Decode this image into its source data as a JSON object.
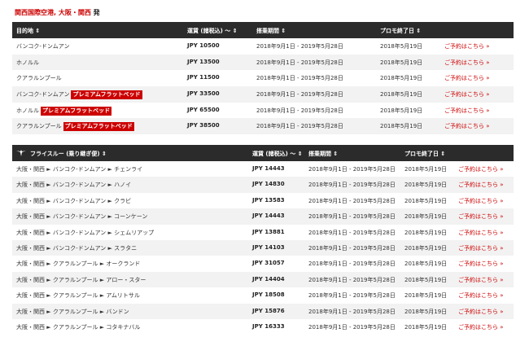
{
  "page": {
    "origin": "関西国際空港, 大阪・関西",
    "origin_suffix": "発"
  },
  "table1": {
    "headers": {
      "destination": "目的地 ⇕",
      "fare": "運賃 (諸税込) ～ ⇕",
      "period": "搭乗期間 ⇕",
      "promo_end": "プロモ終了日 ⇕"
    },
    "rows": [
      {
        "dest": "バンコク-ドンムアン",
        "badge": "",
        "fare": "JPY 10500",
        "period": "2018年9月1日 - 2019年5月28日",
        "end": "2018年5月19日",
        "link": "ご予約はこちら »"
      },
      {
        "dest": "ホノルル",
        "badge": "",
        "fare": "JPY 13500",
        "period": "2018年9月1日 - 2019年5月28日",
        "end": "2018年5月19日",
        "link": "ご予約はこちら »"
      },
      {
        "dest": "クアラルンプール",
        "badge": "",
        "fare": "JPY 11500",
        "period": "2018年9月1日 - 2019年5月28日",
        "end": "2018年5月19日",
        "link": "ご予約はこちら »"
      },
      {
        "dest": "バンコク-ドンムアン",
        "badge": "プレミアムフラットベッド",
        "fare": "JPY 33500",
        "period": "2018年9月1日 - 2019年5月28日",
        "end": "2018年5月19日",
        "link": "ご予約はこちら »"
      },
      {
        "dest": "ホノルル",
        "badge": "プレミアムフラットベッド",
        "fare": "JPY 65500",
        "period": "2018年9月1日 - 2019年5月28日",
        "end": "2018年5月19日",
        "link": "ご予約はこちら »"
      },
      {
        "dest": "クアラルンプール",
        "badge": "プレミアムフラットベッド",
        "fare": "JPY 38500",
        "period": "2018年9月1日 - 2019年5月28日",
        "end": "2018年5月19日",
        "link": "ご予約はこちら »"
      }
    ]
  },
  "table2": {
    "headers": {
      "destination": "フライスルー (乗り継ぎ便) ⇕",
      "fare": "運賃 (諸税込) ～ ⇕",
      "period": "搭乗期間 ⇕",
      "promo_end": "プロモ終了日 ⇕"
    },
    "rows": [
      {
        "dest": "大阪・関西 ► バンコク-ドンムアン ► チェンライ",
        "fare": "JPY 14443",
        "period": "2018年9月1日 - 2019年5月28日",
        "end": "2018年5月19日",
        "link": "ご予約はこちら »"
      },
      {
        "dest": "大阪・関西 ► バンコク-ドンムアン ► ハノイ",
        "fare": "JPY 14830",
        "period": "2018年9月1日 - 2019年5月28日",
        "end": "2018年5月19日",
        "link": "ご予約はこちら »"
      },
      {
        "dest": "大阪・関西 ► バンコク-ドンムアン ► クラビ",
        "fare": "JPY 13583",
        "period": "2018年9月1日 - 2019年5月28日",
        "end": "2018年5月19日",
        "link": "ご予約はこちら »"
      },
      {
        "dest": "大阪・関西 ► バンコク-ドンムアン ► コーンケーン",
        "fare": "JPY 14443",
        "period": "2018年9月1日 - 2019年5月28日",
        "end": "2018年5月19日",
        "link": "ご予約はこちら »"
      },
      {
        "dest": "大阪・関西 ► バンコク-ドンムアン ► シェムリアップ",
        "fare": "JPY 13881",
        "period": "2018年9月1日 - 2019年5月28日",
        "end": "2018年5月19日",
        "link": "ご予約はこちら »"
      },
      {
        "dest": "大阪・関西 ► バンコク-ドンムアン ► スラタニ",
        "fare": "JPY 14103",
        "period": "2018年9月1日 - 2019年5月28日",
        "end": "2018年5月19日",
        "link": "ご予約はこちら »"
      },
      {
        "dest": "大阪・関西 ► クアラルンプール ► オークランド",
        "fare": "JPY 31057",
        "period": "2018年9月1日 - 2019年5月28日",
        "end": "2018年5月19日",
        "link": "ご予約はこちら »"
      },
      {
        "dest": "大阪・関西 ► クアラルンプール ► アロー・スター",
        "fare": "JPY 14404",
        "period": "2018年9月1日 - 2019年5月28日",
        "end": "2018年5月19日",
        "link": "ご予約はこちら »"
      },
      {
        "dest": "大阪・関西 ► クアラルンプール ► アムリトサル",
        "fare": "JPY 18508",
        "period": "2018年9月1日 - 2019年5月28日",
        "end": "2018年5月19日",
        "link": "ご予約はこちら »"
      },
      {
        "dest": "大阪・関西 ► クアラルンプール ► バンドン",
        "fare": "JPY 15876",
        "period": "2018年9月1日 - 2019年5月28日",
        "end": "2018年5月19日",
        "link": "ご予約はこちら »"
      },
      {
        "dest": "大阪・関西 ► クアラルンプール ► コタキナバル",
        "fare": "JPY 16333",
        "period": "2018年9月1日 - 2019年5月28日",
        "end": "2018年5月19日",
        "link": "ご予約はこちら »"
      }
    ]
  },
  "colors": {
    "accent": "#cc0000",
    "header_bg": "#2b2b2b",
    "row_alt": "#f2f2f2"
  },
  "icons": {
    "flythrough_logo": "winged-logo-icon"
  }
}
